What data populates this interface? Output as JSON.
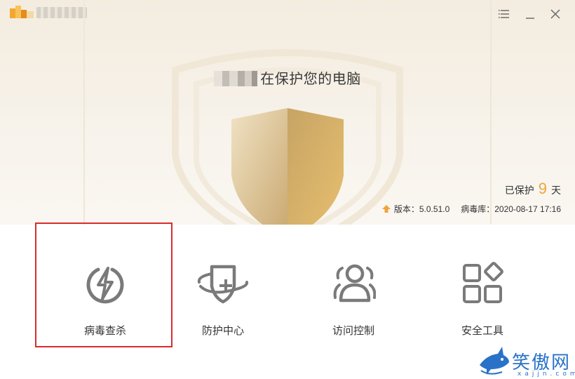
{
  "window": {
    "title": ""
  },
  "titlebar": {
    "menu_icon": "menu-icon",
    "minimize_icon": "minimize-icon",
    "close_icon": "close-icon"
  },
  "hero": {
    "status_text": "在保护您的电脑",
    "protected_prefix": "已保护",
    "protected_days": "9",
    "protected_suffix": "天",
    "version_label": "版本：5.0.51.0",
    "virus_db_label": "病毒库：2020-08-17 17:16"
  },
  "actions": [
    {
      "label": "病毒查杀",
      "icon": "lightning-circle-icon",
      "selected": true
    },
    {
      "label": "防护中心",
      "icon": "shield-plus-icon",
      "selected": false
    },
    {
      "label": "访问控制",
      "icon": "users-icon",
      "selected": false
    },
    {
      "label": "安全工具",
      "icon": "apps-grid-icon",
      "selected": false
    }
  ],
  "watermark": {
    "text": "笑傲网",
    "sub": "xajjn.com"
  },
  "colors": {
    "accent_orange": "#f0a338",
    "selection_red": "#d82c2c",
    "shield_gold": "#c9a86b",
    "icon_gray": "#7a7a7a"
  }
}
